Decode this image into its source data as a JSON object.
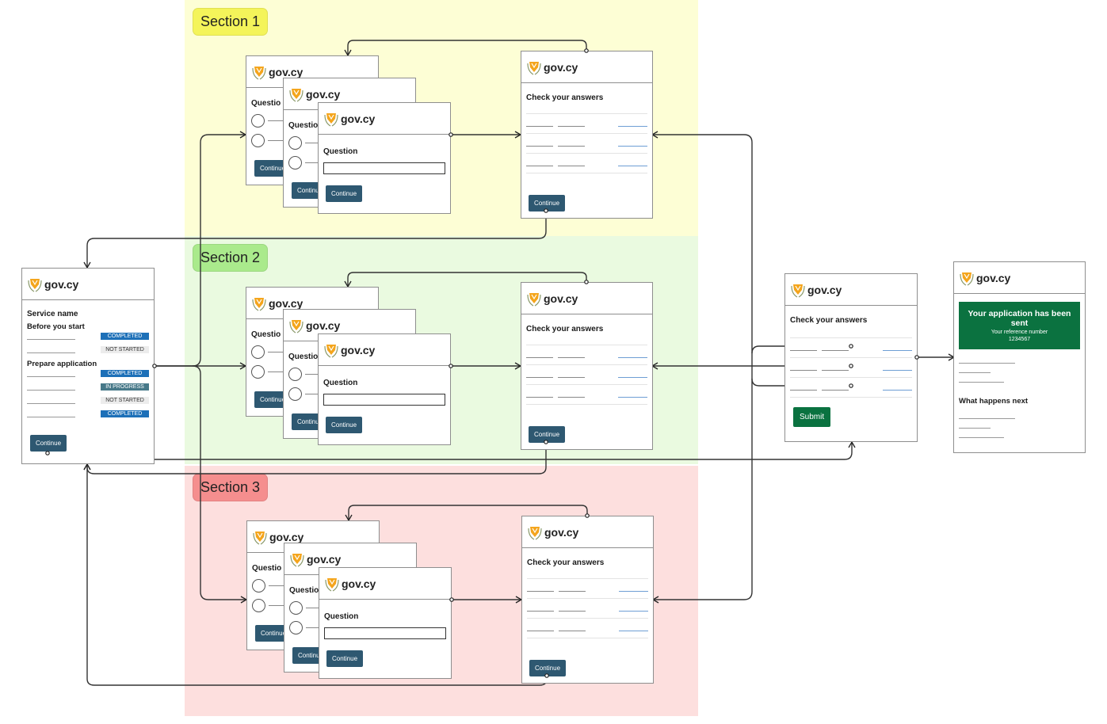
{
  "brand": {
    "logo_text": "gov.cy",
    "crest_icon": "cyprus-crest-icon"
  },
  "colors": {
    "section1": "#fdfed5",
    "section2": "#eafae0",
    "section3": "#fddfde",
    "button": "#2e5871",
    "submit": "#0a7240",
    "tag_completed": "#1d70b8",
    "tag_in_progress": "#477989",
    "tag_not_started": "#ececec"
  },
  "sections": [
    {
      "label": "Section 1",
      "question_label": "Question",
      "question_partial": "Questio",
      "continue_label": "Continue",
      "cya_title": "Check your answers"
    },
    {
      "label": "Section 2",
      "question_label": "Question",
      "question_partial": "Questio",
      "continue_label": "Continue",
      "cya_title": "Check your answers"
    },
    {
      "label": "Section 3",
      "question_label": "Question",
      "question_partial": "Questio",
      "continue_label": "Continue",
      "cya_title": "Check your answers"
    }
  ],
  "task_list": {
    "service_name": "Service name",
    "group1_heading": "Before you start",
    "group1_tasks": [
      {
        "status": "COMPLETED"
      },
      {
        "status": "NOT STARTED"
      }
    ],
    "group2_heading": "Prepare application",
    "group2_tasks": [
      {
        "status": "COMPLETED"
      },
      {
        "status": "IN PROGRESS"
      },
      {
        "status": "NOT STARTED"
      },
      {
        "status": "COMPLETED"
      }
    ],
    "continue_label": "Continue"
  },
  "final_check": {
    "title": "Check your answers",
    "submit_label": "Submit"
  },
  "confirmation": {
    "banner_title": "Your application has been sent",
    "reference_label": "Your reference number",
    "reference_number": "1234567",
    "what_next": "What happens next"
  }
}
